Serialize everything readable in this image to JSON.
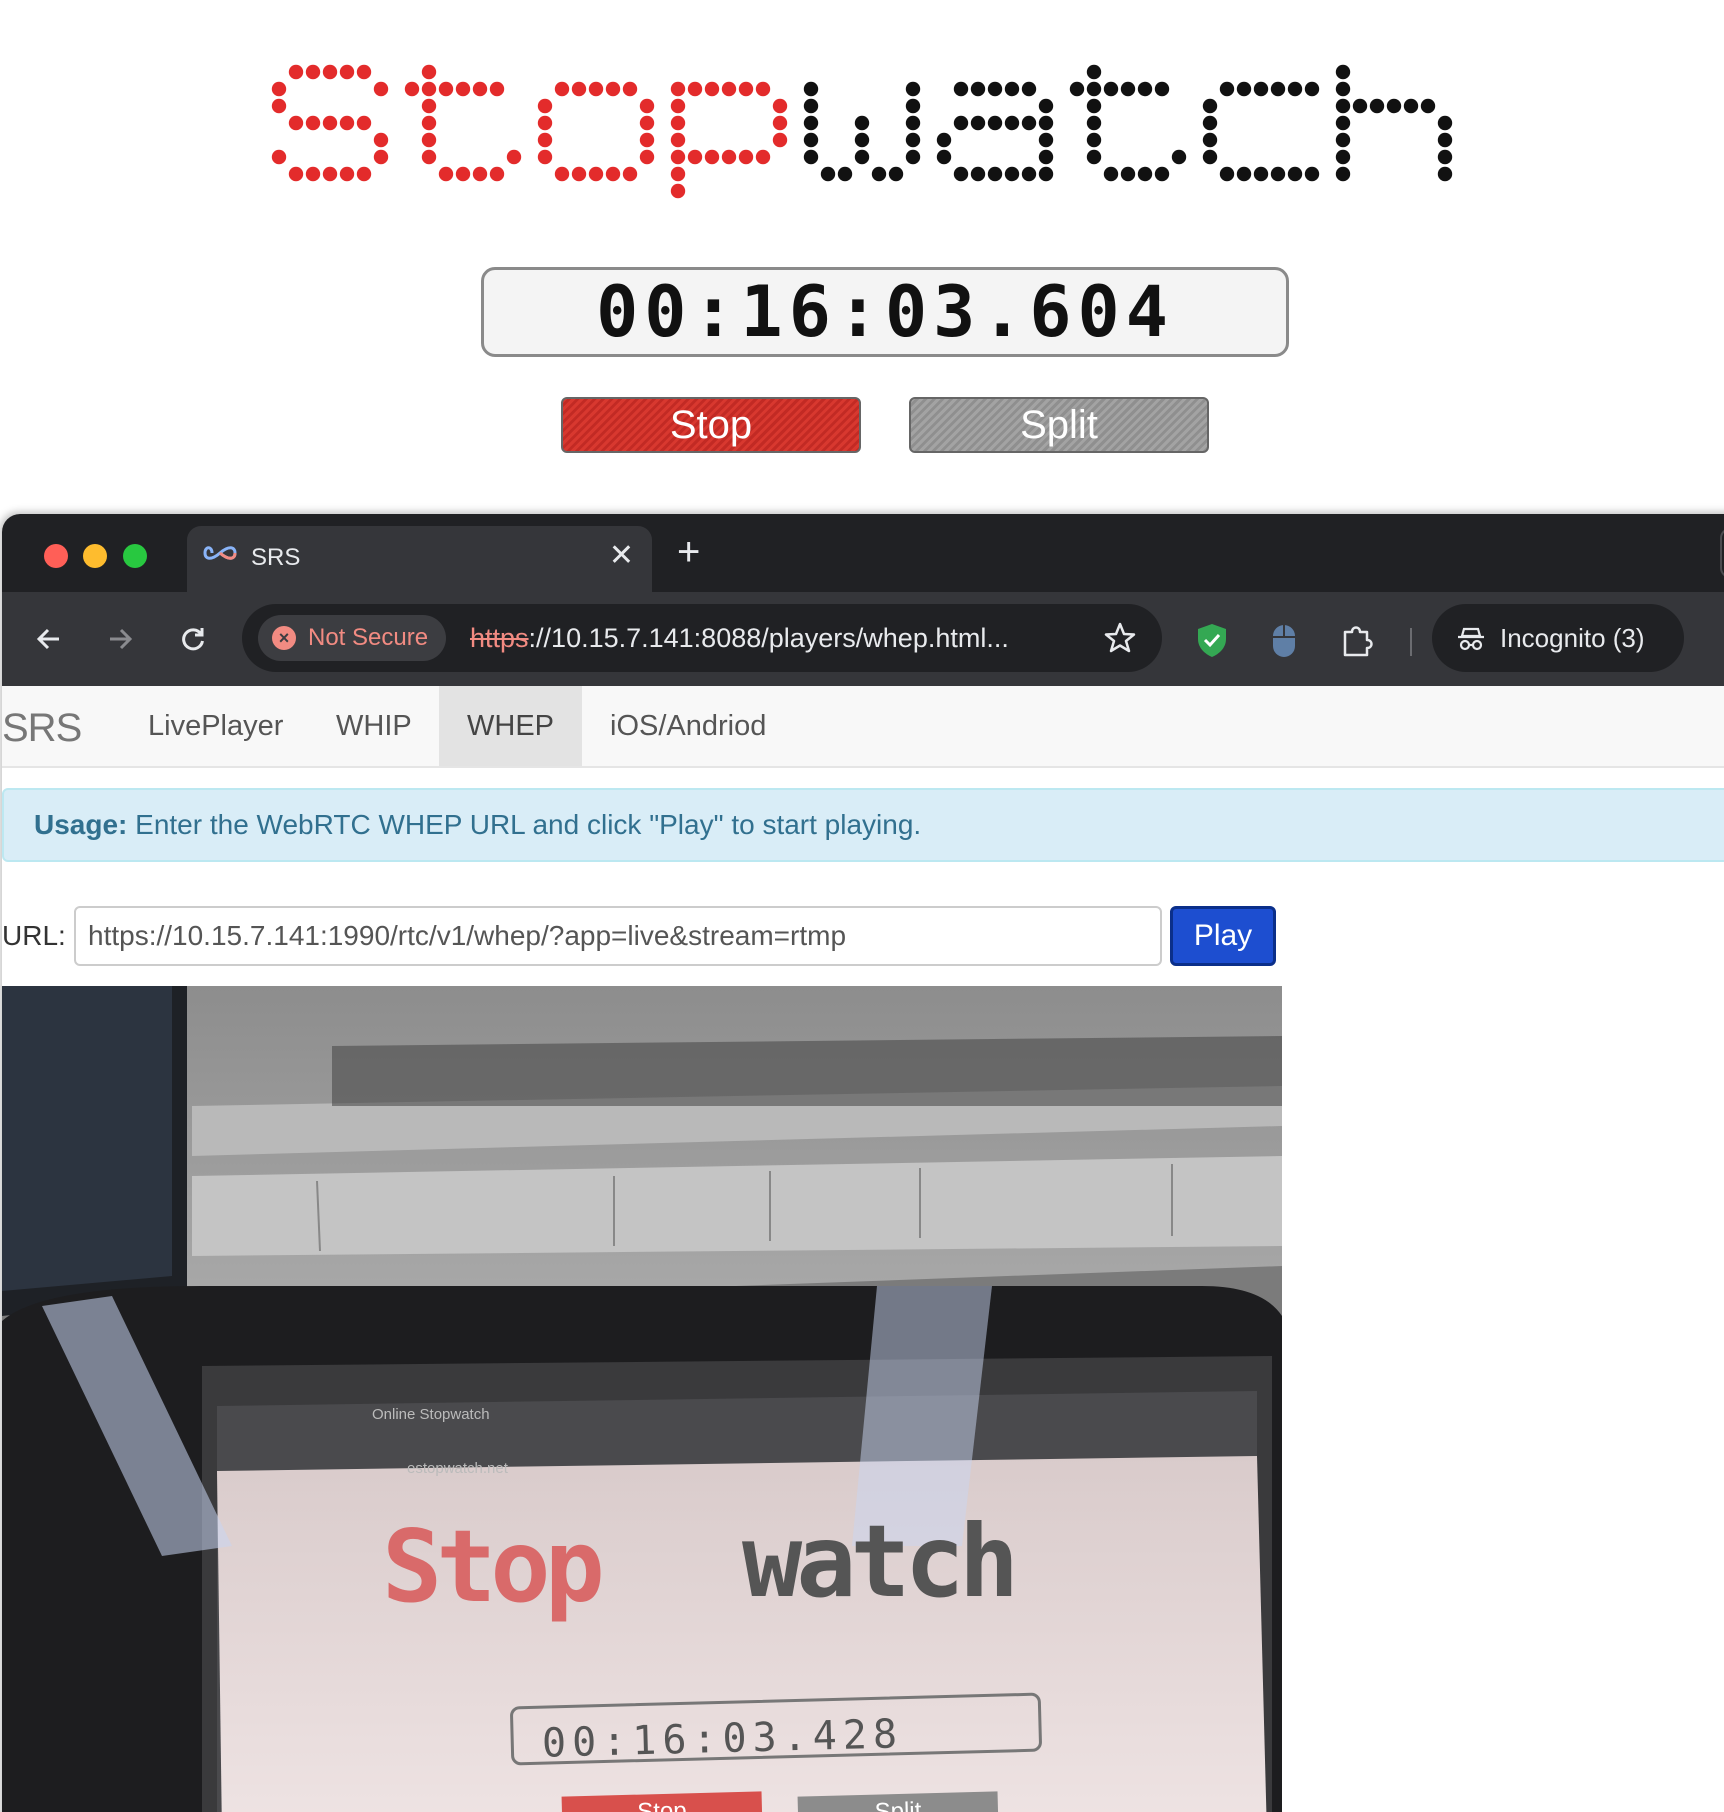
{
  "stopwatch": {
    "logo_text": "Stopwatch",
    "time": "00:16:03.604",
    "stop_label": "Stop",
    "split_label": "Split",
    "colors": {
      "stop": "#c22a24",
      "split": "#8f8f8f",
      "logo_red": "#e32b2b",
      "logo_black": "#111111"
    }
  },
  "browser": {
    "tab": {
      "title": "SRS",
      "icon": "srs-infinity-icon",
      "close_icon": "close-icon"
    },
    "new_tab_icon": "plus-icon",
    "toolbar": {
      "back_icon": "back-arrow-icon",
      "forward_icon": "forward-arrow-icon",
      "reload_icon": "reload-icon",
      "security_label": "Not Secure",
      "url_scheme": "https",
      "url_rest": "://10.15.7.141:8088/players/whep.html...",
      "bookmark_icon": "star-icon",
      "extensions": [
        "shield-check-icon",
        "mouse-icon",
        "puzzle-icon"
      ],
      "incognito_label": "Incognito (3)"
    }
  },
  "page": {
    "brand": "SRS",
    "nav": [
      "LivePlayer",
      "WHIP",
      "WHEP",
      "iOS/Andriod"
    ],
    "active_nav": "WHEP",
    "usage_bold": "Usage:",
    "usage_text": " Enter the WebRTC WHEP URL and click \"Play\" to start playing.",
    "url_label": "URL:",
    "url_value": "https://10.15.7.141:1990/rtc/v1/whep/?app=live&stream=rtmp",
    "play_label": "Play",
    "video": {
      "stopwatch_time": "00:16:03.428",
      "stop_label": "Stop",
      "split_label": "Split",
      "tab_title": "Online Stopwatch",
      "url": "estopwatch.net"
    }
  }
}
